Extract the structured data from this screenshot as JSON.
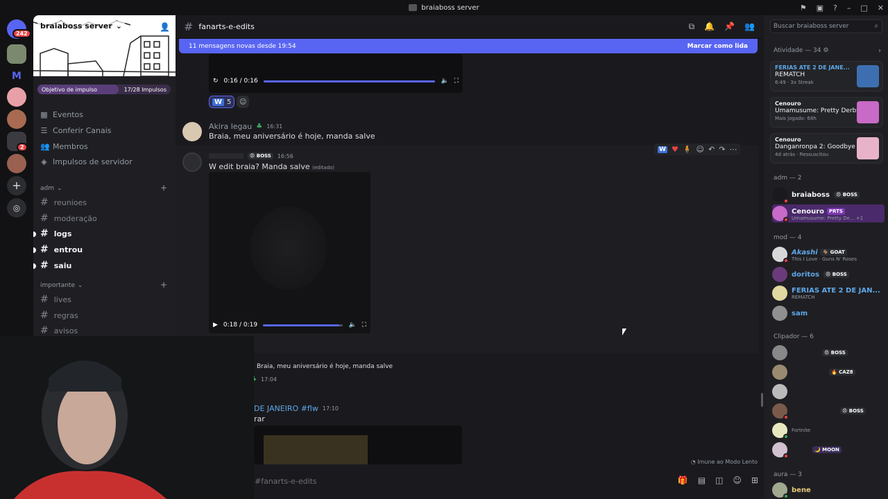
{
  "window": {
    "title": "braiaboss server"
  },
  "guilds": {
    "home_badge": "242",
    "guild_badge": "2"
  },
  "server": {
    "name": "braiaboss server"
  },
  "boost": {
    "goal_label": "Objetivo de impulso",
    "count": "17/28 Impulsos",
    "progress": 0.61
  },
  "nav": [
    {
      "label": "Eventos"
    },
    {
      "label": "Conferir Canais"
    },
    {
      "label": "Membros"
    },
    {
      "label": "Impulsos de servidor"
    }
  ],
  "categories": {
    "adm": "adm",
    "importante": "importante"
  },
  "channels_adm": [
    {
      "name": "reunioes",
      "unread": false
    },
    {
      "name": "moderação",
      "unread": false
    },
    {
      "name": "logs",
      "unread": true
    },
    {
      "name": "entrou",
      "unread": true
    },
    {
      "name": "saiu",
      "unread": true
    }
  ],
  "channels_importante": [
    {
      "name": "lives"
    },
    {
      "name": "regras"
    },
    {
      "name": "avisos"
    }
  ],
  "channel": {
    "name": "fanarts-e-edits"
  },
  "banner": {
    "text": "11 mensagens novas desde 19:54",
    "action": "Marcar como lida"
  },
  "player1": {
    "time": "0:16 / 0:16",
    "progress": 1.0
  },
  "reaction1": {
    "emoji": "W",
    "count": "5"
  },
  "msg_akira": {
    "author": "Akira legau",
    "time": "16:31",
    "text": "Braia, meu aniversário é hoje, manda salve"
  },
  "msg_edit": {
    "tag": "BOSS",
    "time": "16:56",
    "text": "W edit braia? Manda salve",
    "edited": "(editado)"
  },
  "player2": {
    "time": "0:18 / 0:19",
    "progress": 0.95
  },
  "msg_reply": {
    "text": "Braia, meu aniversário é hoje, manda salve",
    "time": "17:04"
  },
  "msg_ferias": {
    "author_fragment": "DE JANEIRO #flw",
    "time": "17:10",
    "text_fragment": "rar"
  },
  "slowmode": {
    "text": "Imune ao Modo Lento"
  },
  "composer": {
    "placeholder": "#fanarts-e-edits"
  },
  "members_panel": {
    "search_placeholder": "Buscar braiaboss server",
    "activity_header": "Atividade — 34",
    "activities": [
      {
        "who": "FERIAS ATE 2 DE JANE...",
        "game": "REMATCH",
        "meta": "6:49 · 3x Streak",
        "color": "#3d6fb0"
      },
      {
        "who": "Cenouro",
        "game": "Umamusume: Pretty Derby",
        "meta": "Mais jogado: 68h",
        "color": "#c86ac8"
      },
      {
        "who": "Cenouro",
        "game": "Danganronpa 2: Goodbye D...",
        "meta": "4d atrás · Ressuscitou",
        "color": "#e8b3c8"
      }
    ],
    "groups": [
      {
        "label": "adm — 2"
      },
      {
        "label": "mod — 4"
      },
      {
        "label": "Clipador — 6"
      },
      {
        "label": "aura — 3"
      }
    ],
    "members": {
      "braiaboss": {
        "name": "braiaboss",
        "tag": "BOSS"
      },
      "cenouro": {
        "name": "Cenouro",
        "tag": "PRTS",
        "sub": "Umamusume: Pretty De... +1"
      },
      "akashi": {
        "name": "Akashi",
        "tag": "GOAT",
        "sub": "This I Love · Guns N' Roses"
      },
      "doritos": {
        "name": "doritos",
        "tag": "BOSS"
      },
      "ferias": {
        "name": "FERIAS ATE 2 DE JAN...",
        "sub": "REMATCH"
      },
      "sam": {
        "name": "sam"
      },
      "clip1": {
        "tag": "BOSS"
      },
      "clip2": {
        "tag": "CAZ8"
      },
      "clip4": {
        "tag": "BOSS"
      },
      "clip5": {
        "sub": "Fortnite"
      },
      "clip6": {
        "tag": "MOON"
      },
      "bene": {
        "name": "bene"
      }
    }
  }
}
